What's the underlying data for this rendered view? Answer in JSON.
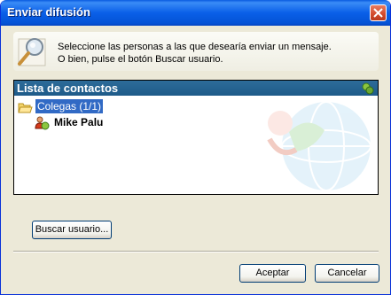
{
  "window": {
    "title": "Enviar difusión"
  },
  "header": {
    "line1": "Seleccione las personas a las que desearía enviar un mensaje.",
    "line2": "O bien, pulse el botón Buscar usuario."
  },
  "contacts": {
    "title": "Lista de contactos",
    "group": "Colegas (1/1)",
    "user": "Mike Palu"
  },
  "buttons": {
    "search": "Buscar usuario...",
    "ok": "Aceptar",
    "cancel": "Cancelar"
  },
  "colors": {
    "titlebar": "#0a5fe8",
    "list_header": "#1e5b89",
    "selection": "#316ac5",
    "dialog_bg": "#ece9d8"
  }
}
